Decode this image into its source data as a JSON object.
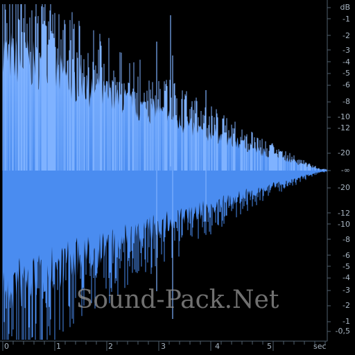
{
  "colors": {
    "background": "#000000",
    "waveform": "#4a8cf0",
    "waveform_light": "#7fb2ff",
    "axis": "#51606e",
    "label": "#a9b6c3"
  },
  "db_scale": {
    "unit": "dB",
    "labels": [
      "-1",
      "-2",
      "-3",
      "-4",
      "-5",
      "-6",
      "-8",
      "-10",
      "-12",
      "-20",
      "-∞",
      "-20",
      "-12",
      "-10",
      "-8",
      "-6",
      "-5",
      "-4",
      "-3",
      "-2",
      "-1",
      "-0,5"
    ]
  },
  "time_scale": {
    "unit": "sec",
    "labels": [
      "0",
      "1",
      "2",
      "3",
      "4",
      "5"
    ]
  },
  "watermark": "Sound-Pack.Net"
}
